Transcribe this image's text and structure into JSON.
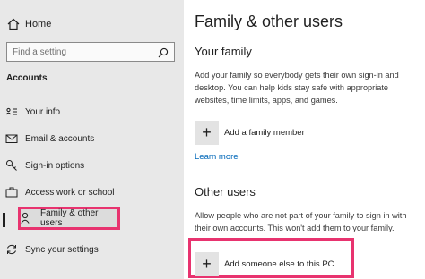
{
  "sidebar": {
    "home_label": "Home",
    "search_placeholder": "Find a setting",
    "section_title": "Accounts",
    "items": [
      {
        "label": "Your info",
        "icon": "person-card-icon"
      },
      {
        "label": "Email & accounts",
        "icon": "mail-icon"
      },
      {
        "label": "Sign-in options",
        "icon": "key-icon"
      },
      {
        "label": "Access work or school",
        "icon": "briefcase-icon"
      },
      {
        "label": "Family & other users",
        "icon": "person-add-icon",
        "selected": true
      },
      {
        "label": "Sync your settings",
        "icon": "sync-icon"
      }
    ]
  },
  "main": {
    "title": "Family & other users",
    "family": {
      "heading": "Your family",
      "description": "Add your family so everybody gets their own sign-in and desktop. You can help kids stay safe with appropriate websites, time limits, apps, and games.",
      "add_label": "Add a family member",
      "learn_more": "Learn more"
    },
    "others": {
      "heading": "Other users",
      "description": "Allow people who are not part of your family to sign in with their own accounts. This won't add them to your family.",
      "add_label": "Add someone else to this PC"
    }
  },
  "colors": {
    "highlight": "#e8336f",
    "link": "#0067b8",
    "sidebar_bg": "#e8e8e8"
  }
}
